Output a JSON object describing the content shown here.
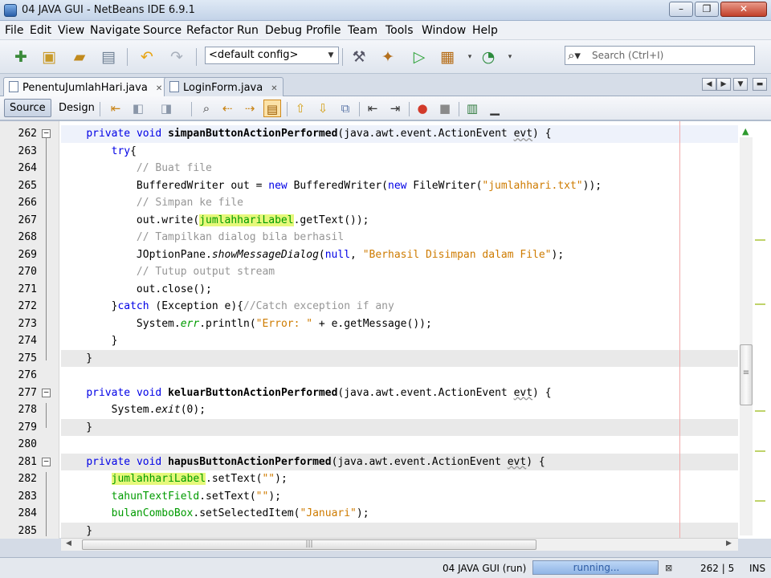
{
  "window": {
    "title": "04 JAVA GUI - NetBeans IDE 6.9.1",
    "buttons": [
      "–",
      "❐",
      "✕"
    ]
  },
  "menubar": {
    "items": [
      "File",
      "Edit",
      "View",
      "Navigate",
      "Source",
      "Refactor",
      "Run",
      "Debug",
      "Profile",
      "Team",
      "Tools",
      "Window",
      "Help"
    ]
  },
  "toolbar": {
    "config": "<default config>",
    "search_placeholder": "Search (Ctrl+I)"
  },
  "tabs": [
    {
      "label": "PenentuJumlahHari.java",
      "active": true
    },
    {
      "label": "LoginForm.java",
      "active": false
    }
  ],
  "editor_toolbar": {
    "source": "Source",
    "design": "Design"
  },
  "code": {
    "lines": [
      {
        "n": "262",
        "html": "<span class=\"k\">private</span> <span class=\"k\">void</span> <span class=\"m\">simpanButtonActionPerformed</span>(java.awt.event.ActionEvent <span class=\"u\">evt</span>) {"
      },
      {
        "n": "263",
        "html": "    <span class=\"k\">try</span>{"
      },
      {
        "n": "264",
        "html": "        <span class=\"c\">// Buat file</span>"
      },
      {
        "n": "265",
        "html": "        BufferedWriter out = <span class=\"k\">new</span> BufferedWriter(<span class=\"k\">new</span> FileWriter(<span class=\"s\">\"jumlahhari.txt\"</span>));"
      },
      {
        "n": "266",
        "html": "        <span class=\"c\">// Simpan ke file</span>"
      },
      {
        "n": "267",
        "html": "        out.write(<span class=\"f rv\">jumlahhariLabel</span>.getText());"
      },
      {
        "n": "268",
        "html": "        <span class=\"c\">// Tampilkan dialog bila berhasil</span>"
      },
      {
        "n": "269",
        "html": "        JOptionPane.<span class=\"i\">showMessageDialog</span>(<span class=\"k\">null</span>, <span class=\"s\">\"Berhasil Disimpan dalam File\"</span>);"
      },
      {
        "n": "270",
        "html": "        <span class=\"c\">// Tutup output stream</span>"
      },
      {
        "n": "271",
        "html": "        out.close();"
      },
      {
        "n": "272",
        "html": "    }<span class=\"k\">catch</span> (Exception e){<span class=\"c\">//Catch exception if any</span>"
      },
      {
        "n": "273",
        "html": "        System.<span class=\"f i\">err</span>.println(<span class=\"s\">\"Error: \"</span> + e.getMessage());"
      },
      {
        "n": "274",
        "html": "    }"
      },
      {
        "n": "275",
        "html": "}"
      },
      {
        "n": "276",
        "html": ""
      },
      {
        "n": "277",
        "html": "<span class=\"k\">private</span> <span class=\"k\">void</span> <span class=\"m\">keluarButtonActionPerformed</span>(java.awt.event.ActionEvent <span class=\"u\">evt</span>) {"
      },
      {
        "n": "278",
        "html": "    System.<span class=\"i\">exit</span>(0);"
      },
      {
        "n": "279",
        "html": "}"
      },
      {
        "n": "280",
        "html": ""
      },
      {
        "n": "281",
        "html": "<span class=\"k\">private</span> <span class=\"k\">void</span> <span class=\"m\">hapusButtonActionPerformed</span>(java.awt.event.ActionEvent <span class=\"u\">evt</span>) {"
      },
      {
        "n": "282",
        "html": "    <span class=\"f rv\">jumlahhariLabel</span>.setText(<span class=\"s\">\"\"</span>);"
      },
      {
        "n": "283",
        "html": "    <span class=\"f\">tahunTextField</span>.setText(<span class=\"s\">\"\"</span>);"
      },
      {
        "n": "284",
        "html": "    <span class=\"f\">bulanComboBox</span>.setSelectedItem(<span class=\"s\">\"Januari\"</span>);"
      },
      {
        "n": "285",
        "html": "}"
      }
    ]
  },
  "status": {
    "project": "04 JAVA GUI (run)",
    "progress": "running...",
    "progress_fraction": 1.0,
    "position": "262 | 5",
    "mode": "INS"
  }
}
